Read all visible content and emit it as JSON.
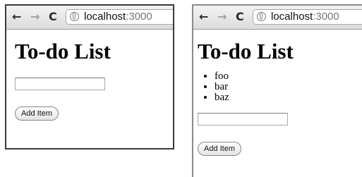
{
  "browser": {
    "back_icon": "back-arrow-icon",
    "forward_icon": "forward-arrow-icon",
    "reload_icon": "reload-icon",
    "site_icon": "globe-icon"
  },
  "windows": [
    {
      "url_host": "localhost",
      "url_port": ":3000",
      "title": "To-do List",
      "items": [],
      "input_value": "",
      "button_label": "Add Item"
    },
    {
      "url_host": "localhost",
      "url_port": ":3000",
      "title": "To-do List",
      "items": [
        "foo",
        "bar",
        "baz"
      ],
      "input_value": "",
      "button_label": "Add Item"
    }
  ]
}
